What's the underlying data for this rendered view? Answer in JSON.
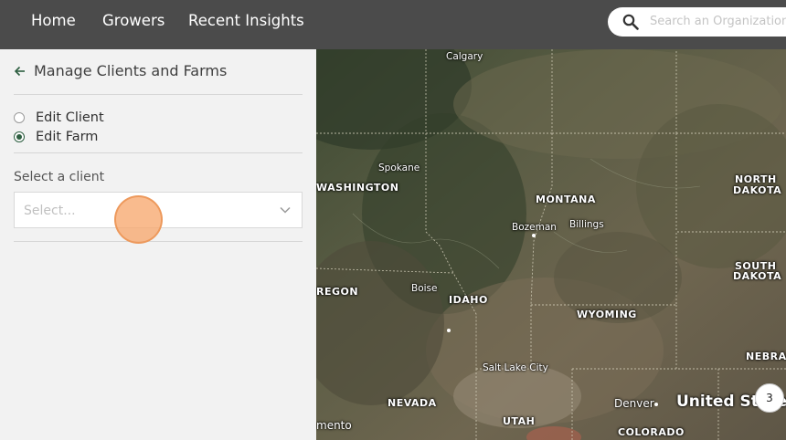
{
  "nav": {
    "links": [
      "Home",
      "Growers",
      "Recent Insights"
    ],
    "search_placeholder": "Search an Organization"
  },
  "sidebar": {
    "back_title": "Manage Clients and Farms",
    "radio_options": [
      {
        "label": "Edit Client",
        "checked": false
      },
      {
        "label": "Edit Farm",
        "checked": true
      }
    ],
    "client_label": "Select a client",
    "client_placeholder": "Select..."
  },
  "map": {
    "labels": {
      "calgary": "Calgary",
      "spokane": "Spokane",
      "washington": "WASHINGTON",
      "montana": "MONTANA",
      "bozeman": "Bozeman",
      "billings": "Billings",
      "north_dakota_1": "NORTH",
      "north_dakota_2": "DAKOTA",
      "south_dakota_1": "SOUTH",
      "south_dakota_2": "DAKOTA",
      "oregon": "REGON",
      "boise": "Boise",
      "idaho": "IDAHO",
      "wyoming": "WYOMING",
      "nebraska": "NEBRAS",
      "salt_lake_city": "Salt Lake City",
      "nevada": "NEVADA",
      "denver": "Denver",
      "united_states": "United States",
      "sacramento": "mento",
      "utah": "UTAH",
      "colorado": "COLORADO"
    },
    "cluster_count": "3"
  },
  "colors": {
    "topbar": "#4b4b4b",
    "radio_accent": "#2d5e40",
    "click_indicator": "#f7a86e"
  }
}
